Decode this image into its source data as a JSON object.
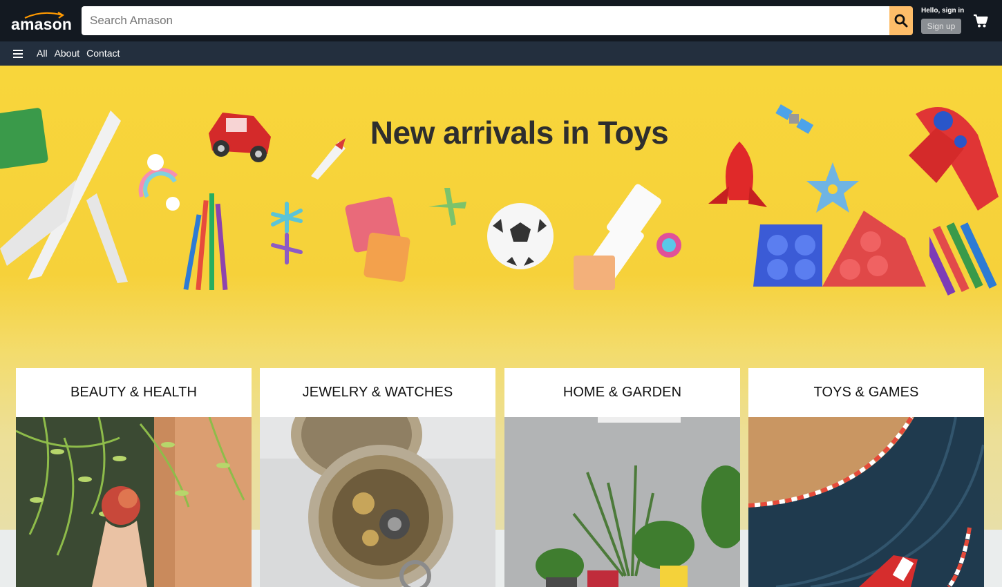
{
  "header": {
    "logo": "amason",
    "search": {
      "placeholder": "Search Amason",
      "value": ""
    },
    "account": {
      "greeting": "Hello, sign in",
      "signup_label": "Sign up"
    },
    "icons": {
      "search": "search-icon",
      "cart": "cart-icon",
      "menu": "hamburger-menu-icon"
    }
  },
  "nav": {
    "links": [
      "All",
      "About",
      "Contact"
    ]
  },
  "hero": {
    "title": "New arrivals in Toys"
  },
  "categories": [
    {
      "title": "BEAUTY & HEALTH"
    },
    {
      "title": "JEWELRY & WATCHES"
    },
    {
      "title": "HOME & GARDEN"
    },
    {
      "title": "TOYS & GAMES"
    }
  ],
  "colors": {
    "topbar": "#131921",
    "navbar": "#232f3e",
    "search_button": "#febd69",
    "hero_yellow": "#f8d63b"
  }
}
